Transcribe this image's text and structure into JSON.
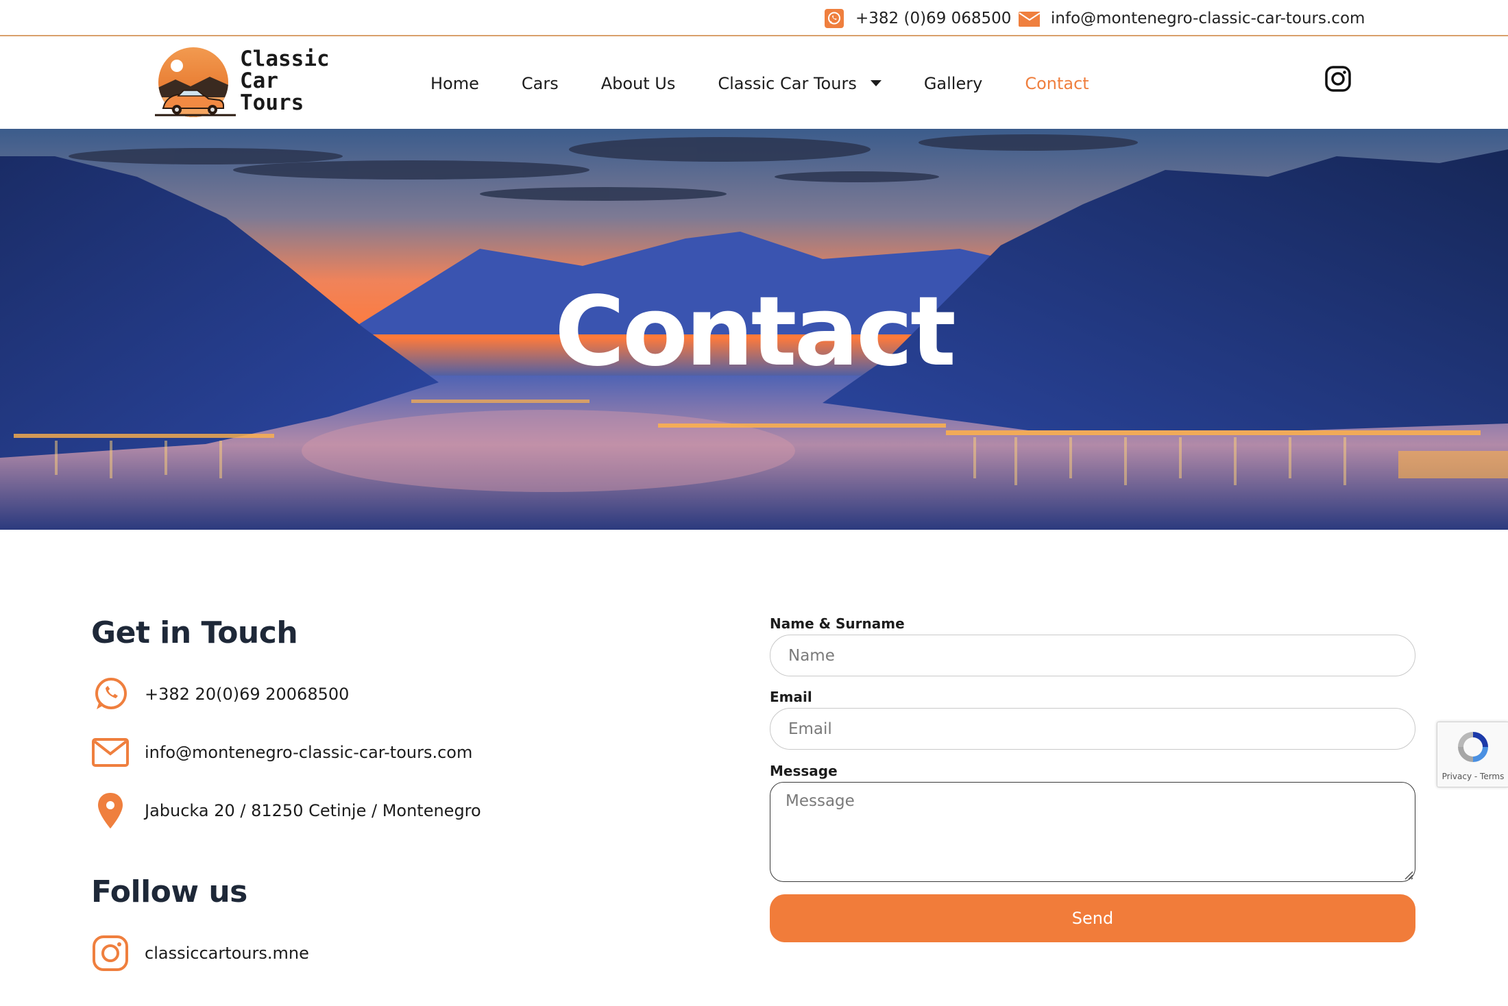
{
  "topbar": {
    "phone": "+382 (0)69 068500",
    "email": "info@montenegro-classic-car-tours.com",
    "phone_icon": "whatsapp-icon",
    "email_icon": "envelope-icon"
  },
  "logo": {
    "line1": "Classic",
    "line2": "Car",
    "line3": "Tours"
  },
  "nav": {
    "items": [
      {
        "label": "Home"
      },
      {
        "label": "Cars"
      },
      {
        "label": "About Us"
      },
      {
        "label": "Classic Car Tours"
      },
      {
        "label": "Gallery"
      },
      {
        "label": "Contact"
      }
    ],
    "active": "Contact",
    "social_icon": "instagram-icon"
  },
  "hero": {
    "title": "Contact"
  },
  "contact": {
    "heading": "Get in Touch",
    "phone": "+382 20(0)69 20068500",
    "email": "info@montenegro-classic-car-tours.com",
    "address": "Jabucka 20 / 81250 Cetinje / Montenegro",
    "follow_heading": "Follow us",
    "instagram": "classiccartours.mne"
  },
  "form": {
    "name_label": "Name & Surname",
    "name_placeholder": "Name",
    "email_label": "Email",
    "email_placeholder": "Email",
    "message_label": "Message",
    "message_placeholder": "Message",
    "submit_label": "Send"
  },
  "recaptcha": {
    "text": "Privacy - Terms"
  },
  "colors": {
    "accent": "#f17c3a",
    "heading": "#1e2838",
    "topbar_rule": "#d9a06b"
  }
}
